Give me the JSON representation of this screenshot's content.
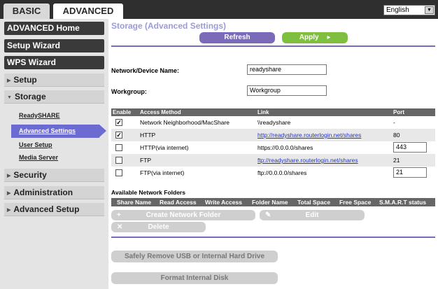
{
  "tabs": [
    {
      "label": "BASIC"
    },
    {
      "label": "ADVANCED"
    }
  ],
  "language": {
    "value": "English"
  },
  "sidebar": {
    "top_buttons": [
      "ADVANCED Home",
      "Setup Wizard",
      "WPS Wizard"
    ],
    "setup": "Setup",
    "storage": "Storage",
    "storage_items": [
      "ReadySHARE",
      "Advanced Settings",
      "User Setup",
      "Media Server"
    ],
    "security": "Security",
    "administration": "Administration",
    "advanced_setup": "Advanced Setup"
  },
  "main": {
    "title": "Storage (Advanced Settings)",
    "refresh_label": "Refresh",
    "apply_label": "Apply",
    "device_name_label": "Network/Device Name:",
    "device_name_value": "readyshare",
    "workgroup_label": "Workgroup:",
    "workgroup_value": "Workgroup",
    "table_headers": [
      "Enable",
      "Access Method",
      "Link",
      "Port"
    ],
    "rows": [
      {
        "checked": true,
        "method": "Network Neighborhood/MacShare",
        "link": "\\\\readyshare",
        "port": "-"
      },
      {
        "checked": true,
        "method": "HTTP",
        "link": "http://readyshare.routerlogin.net/shares",
        "port": "80"
      },
      {
        "checked": false,
        "method": "HTTP(via internet)",
        "link": "https://0.0.0.0/shares",
        "port": "443"
      },
      {
        "checked": false,
        "method": "FTP",
        "link": "ftp://readyshare.routerlogin.net/shares",
        "port": "21"
      },
      {
        "checked": false,
        "method": "FTP(via internet)",
        "link": "ftp://0.0.0.0/shares",
        "port": "21"
      }
    ],
    "folders_title": "Available Network Folders",
    "folder_headers": [
      "Share Name",
      "Read Access",
      "Write Access",
      "Folder Name",
      "Total Space",
      "Free Space",
      "S.M.A.R.T status"
    ],
    "create_folder_label": "Create Network Folder",
    "edit_label": "Edit",
    "delete_label": "Delete",
    "safely_remove_label": "Safely Remove USB or Internal Hard Drive",
    "format_label": "Format Internal Disk"
  }
}
